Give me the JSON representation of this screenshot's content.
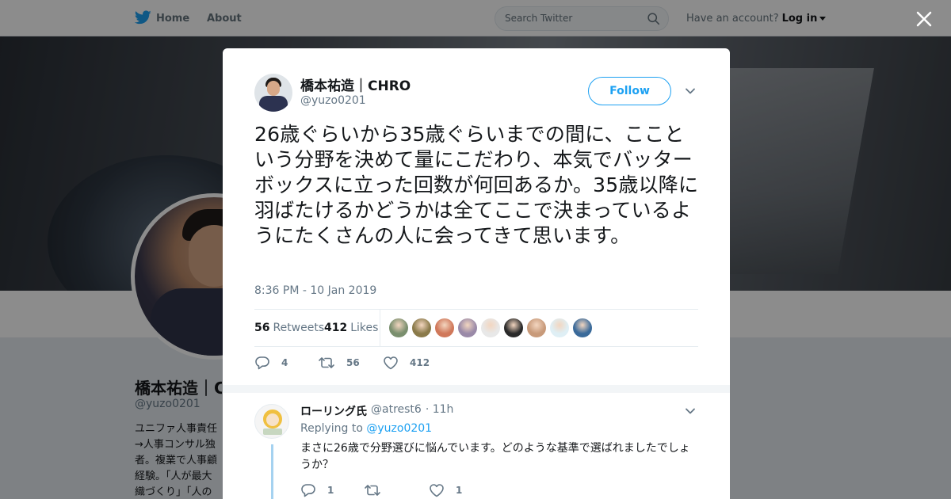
{
  "nav": {
    "home_label": "Home",
    "about_label": "About",
    "search_placeholder": "Search Twitter",
    "account_prompt": "Have an account?",
    "login_label": "Log in"
  },
  "background_profile": {
    "name": "橋本祐造｜C",
    "handle": "@yuzo0201",
    "bio_lines": [
      "ユニファ人事責任",
      "→人事コンサル独",
      "者。複業で人事顧",
      "経験。「人が最大",
      "織づくり」「人の"
    ]
  },
  "tweet": {
    "author_name": "橋本祐造｜CHRO",
    "author_handle": "@yuzo0201",
    "follow_label": "Follow",
    "text": "26歳ぐらいから35歳ぐらいまでの間に、ここという分野を決めて量にこだわり、本気でバッターボックスに立った回数が何回あるか。35歳以降に羽ばたけるかどうかは全てここで決まっているようにたくさんの人に会ってきて思います。",
    "timestamp": "8:36 PM - 10 Jan 2019",
    "retweets_count": "56",
    "retweets_label": "Retweets",
    "likes_count": "412",
    "likes_label": "Likes",
    "reply_count": "4",
    "retweet_action_count": "56",
    "like_action_count": "412",
    "liker_colors": [
      "#7a8f6e",
      "#8a7a4a",
      "#d0785a",
      "#9a8aa8",
      "#e8e8e8",
      "#2a2a2a",
      "#c89a7a",
      "#dfeff5",
      "#3a6a9a"
    ]
  },
  "reply": {
    "author_name": "ローリング氏",
    "author_handle": "@atrest6",
    "time": "· 11h",
    "replying_prefix": "Replying to",
    "replying_to": "@yuzo0201",
    "text": "まさに26歳で分野選びに悩んでいます。どのような基準で選ばれましたでしょうか？",
    "reply_count": "1",
    "like_count": "1"
  },
  "colors": {
    "accent": "#1da1f2",
    "text_primary": "#14171a",
    "text_secondary": "#657786"
  }
}
